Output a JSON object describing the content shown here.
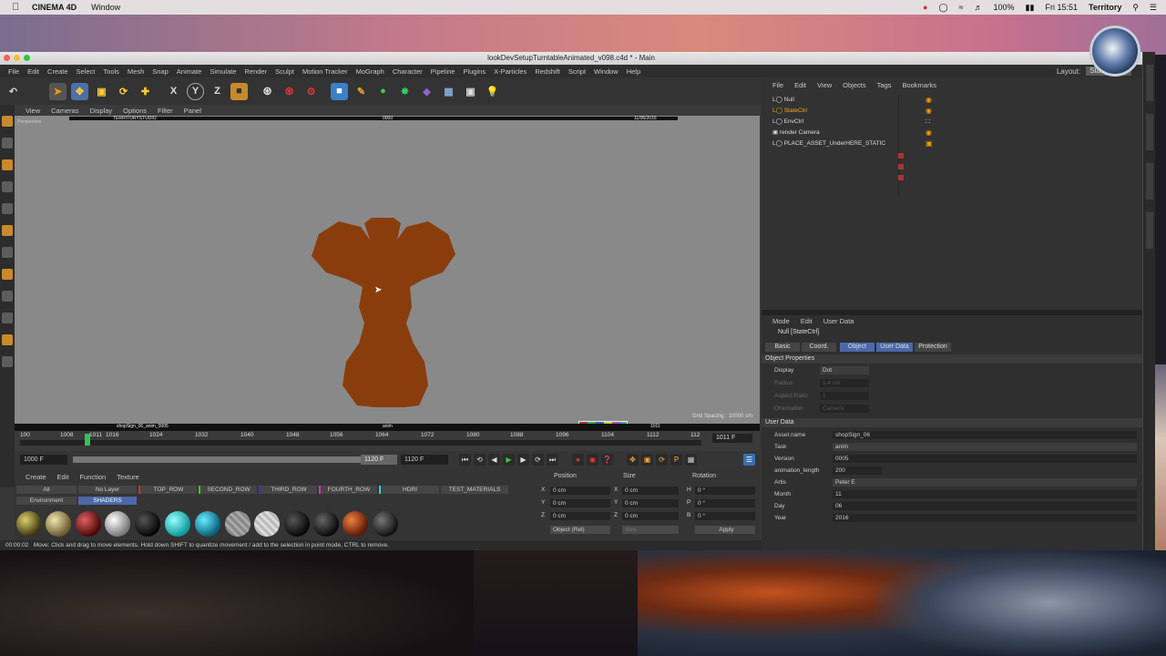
{
  "menubar": {
    "app": "CINEMA 4D",
    "items": [
      "Window"
    ],
    "battery": "100%",
    "clock": "Fri 15:51",
    "user": "Territory"
  },
  "window": {
    "title": "lookDevSetupTurntableAnimated_v098.c4d * - Main",
    "menu": [
      "File",
      "Edit",
      "Create",
      "Select",
      "Tools",
      "Mesh",
      "Snap",
      "Animate",
      "Simulate",
      "Render",
      "Sculpt",
      "Motion Tracker",
      "MoGraph",
      "Character",
      "Pipeline",
      "Plugins",
      "X-Particles",
      "Redshift",
      "Script",
      "Window",
      "Help"
    ],
    "layout_label": "Layout:",
    "layout_value": "Startup"
  },
  "viewport": {
    "menu": [
      "View",
      "Cameras",
      "Display",
      "Options",
      "Filter",
      "Panel"
    ],
    "label": "Perspective",
    "studio_tag": "TERRITORYSTUDIO",
    "center_tag": "0000",
    "date_tag": "11/06/2016",
    "bottom_left": "shopSign_06_anim_0005",
    "bottom_mid": "anim",
    "bottom_right": "1011",
    "grid_spacing": "Grid Spacing : 10000 cm"
  },
  "timeline": {
    "ticks": [
      "100",
      "1008",
      "1011",
      "1016",
      "1024",
      "1032",
      "1040",
      "1048",
      "1056",
      "1064",
      "1072",
      "1080",
      "1088",
      "1096",
      "1104",
      "1112",
      "112"
    ],
    "current_frame": "1011 F"
  },
  "transport": {
    "start": "1000 F",
    "end": "1120 F",
    "preview_end": "1120 F"
  },
  "material": {
    "menu": [
      "Create",
      "Edit",
      "Function",
      "Texture"
    ],
    "tabs": [
      "All",
      "No Layer",
      "TOP_ROW",
      "SECOND_ROW",
      "THIRD_ROW",
      "FOURTH_ROW",
      "HDRI",
      "TEST_MATERIALS"
    ],
    "tabs2": [
      "Environment",
      "SHADERS"
    ]
  },
  "coords": {
    "headers": [
      "Position",
      "Size",
      "Rotation"
    ],
    "rows": [
      {
        "axis": "X",
        "pos": "0 cm",
        "size_axis": "X",
        "size": "0 cm",
        "rot_axis": "H",
        "rot": "0 °"
      },
      {
        "axis": "Y",
        "pos": "0 cm",
        "size_axis": "Y",
        "size": "0 cm",
        "rot_axis": "P",
        "rot": "0 °"
      },
      {
        "axis": "Z",
        "pos": "0 cm",
        "size_axis": "Z",
        "size": "0 cm",
        "rot_axis": "B",
        "rot": "0 °"
      }
    ],
    "mode": "Object (Rel)",
    "size_mode": "Size",
    "apply": "Apply"
  },
  "status": {
    "time": "00:00:02",
    "text": "Move: Click and drag to move elements. Hold down SHIFT to quantize movement / add to the selection in point mode, CTRL to remove."
  },
  "object_manager": {
    "menu": [
      "File",
      "Edit",
      "View",
      "Objects",
      "Tags",
      "Bookmarks"
    ],
    "objects": [
      "Null",
      "StateCtrl",
      "EnvCtrl",
      "render Camera",
      "PLACE_ASSET_UnderHERE_STATIC"
    ]
  },
  "attributes": {
    "menu": [
      "Mode",
      "Edit",
      "User Data"
    ],
    "object_name": "Null [StateCtrl]",
    "tabs": [
      "Basic",
      "Coord.",
      "Object",
      "User Data",
      "Protection"
    ],
    "section_object": "Object Properties",
    "display_label": "Display",
    "display_value": "Dot",
    "radius_label": "Radius",
    "radius_value": "1.4 cm",
    "aspect_label": "Aspect Ratio",
    "aspect_value": "1",
    "orient_label": "Orientation",
    "orient_value": "Camera",
    "section_user": "User Data",
    "user_rows": [
      {
        "label": "Asset name",
        "value": "shopSign_06"
      },
      {
        "label": "Task",
        "value": "anim"
      },
      {
        "label": "Version",
        "value": "0005"
      },
      {
        "label": "animation_length",
        "value": "200"
      },
      {
        "label": "Artis",
        "value": "Peter E"
      },
      {
        "label": "Month",
        "value": "11"
      },
      {
        "label": "Day",
        "value": "06"
      },
      {
        "label": "Year",
        "value": "2016"
      }
    ]
  }
}
